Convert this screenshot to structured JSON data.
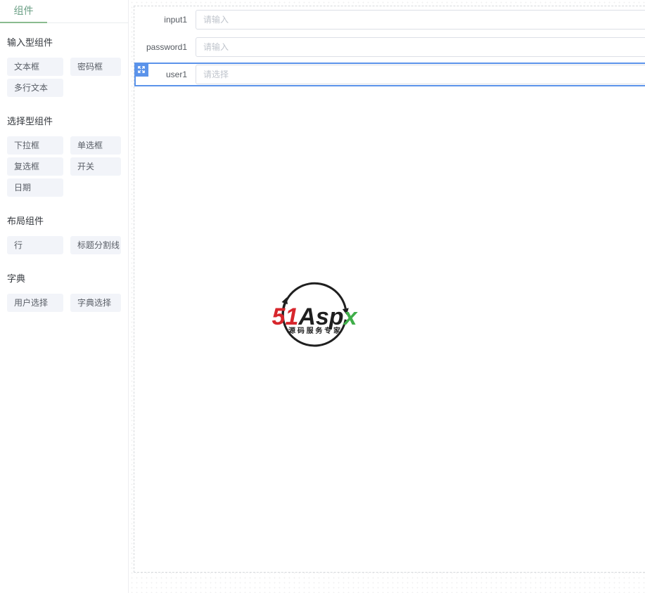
{
  "sidebar": {
    "tab_label": "组件",
    "sections": [
      {
        "title": "输入型组件",
        "items": [
          "文本框",
          "密码框",
          "多行文本"
        ]
      },
      {
        "title": "选择型组件",
        "items": [
          "下拉框",
          "单选框",
          "复选框",
          "开关",
          "日期"
        ]
      },
      {
        "title": "布局组件",
        "items": [
          "行",
          "标题分割线"
        ]
      },
      {
        "title": "字典",
        "items": [
          "用户选择",
          "字典选择"
        ]
      }
    ]
  },
  "canvas": {
    "fields": [
      {
        "label": "input1",
        "placeholder": "请输入"
      },
      {
        "label": "password1",
        "placeholder": "请输入"
      },
      {
        "label": "user1",
        "placeholder": "请选择"
      }
    ]
  },
  "watermark": {
    "brand_51": "51",
    "brand_asp": "Asp",
    "brand_x": "x",
    "tagline": "源 码 服 务 专 家"
  },
  "colors": {
    "tab_active_green": "#6ca086",
    "tab_underline_green": "#8abb8f",
    "selection_blue": "#5b93ea",
    "chip_background": "#f2f4f9",
    "input_border": "#dcdfe6",
    "brand_red": "#d7262c",
    "brand_green": "#3fae49"
  }
}
